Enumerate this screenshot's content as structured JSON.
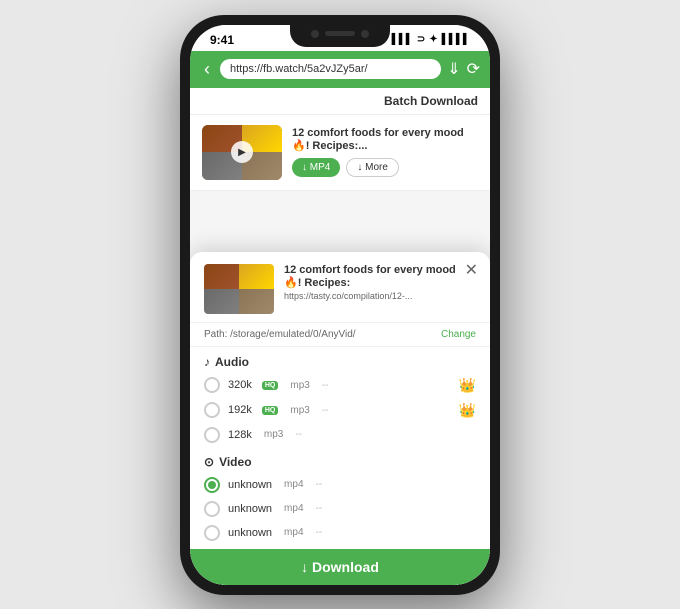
{
  "phone": {
    "status_time": "9:41",
    "status_signal": "▌▌▌",
    "status_wifi": "WiFi",
    "status_battery": "🔋"
  },
  "url_bar": {
    "url": "https://fb.watch/5a2vJZy5ar/",
    "back_icon": "‹"
  },
  "top_area": {
    "batch_download_label": "Batch Download",
    "video_title": "12 comfort foods for every mood 🔥! Recipes:...",
    "btn_mp4_label": "↓ MP4",
    "btn_more_label": "↓ More"
  },
  "modal": {
    "close_icon": "✕",
    "video_title": "12 comfort foods for every mood 🔥! Recipes:",
    "video_url": "https://tasty.co/compilation/12-...",
    "path_label": "Path: /storage/emulated/0/AnyVid/",
    "change_label": "Change",
    "audio_section": "♪ Audio",
    "audio_options": [
      {
        "quality": "320k",
        "badge": "HQ",
        "format": "mp3",
        "dash": "--",
        "crown": true
      },
      {
        "quality": "192k",
        "badge": "HQ",
        "format": "mp3",
        "dash": "--",
        "crown": true
      },
      {
        "quality": "128k",
        "badge": "",
        "format": "mp3",
        "dash": "--",
        "crown": false
      }
    ],
    "video_section": "⊙ Video",
    "video_options": [
      {
        "quality": "unknown",
        "format": "mp4",
        "dash": "--",
        "selected": true
      },
      {
        "quality": "unknown",
        "format": "mp4",
        "dash": "--",
        "selected": false
      },
      {
        "quality": "unknown",
        "format": "mp4",
        "dash": "--",
        "selected": false
      }
    ],
    "download_label": "↓  Download"
  }
}
